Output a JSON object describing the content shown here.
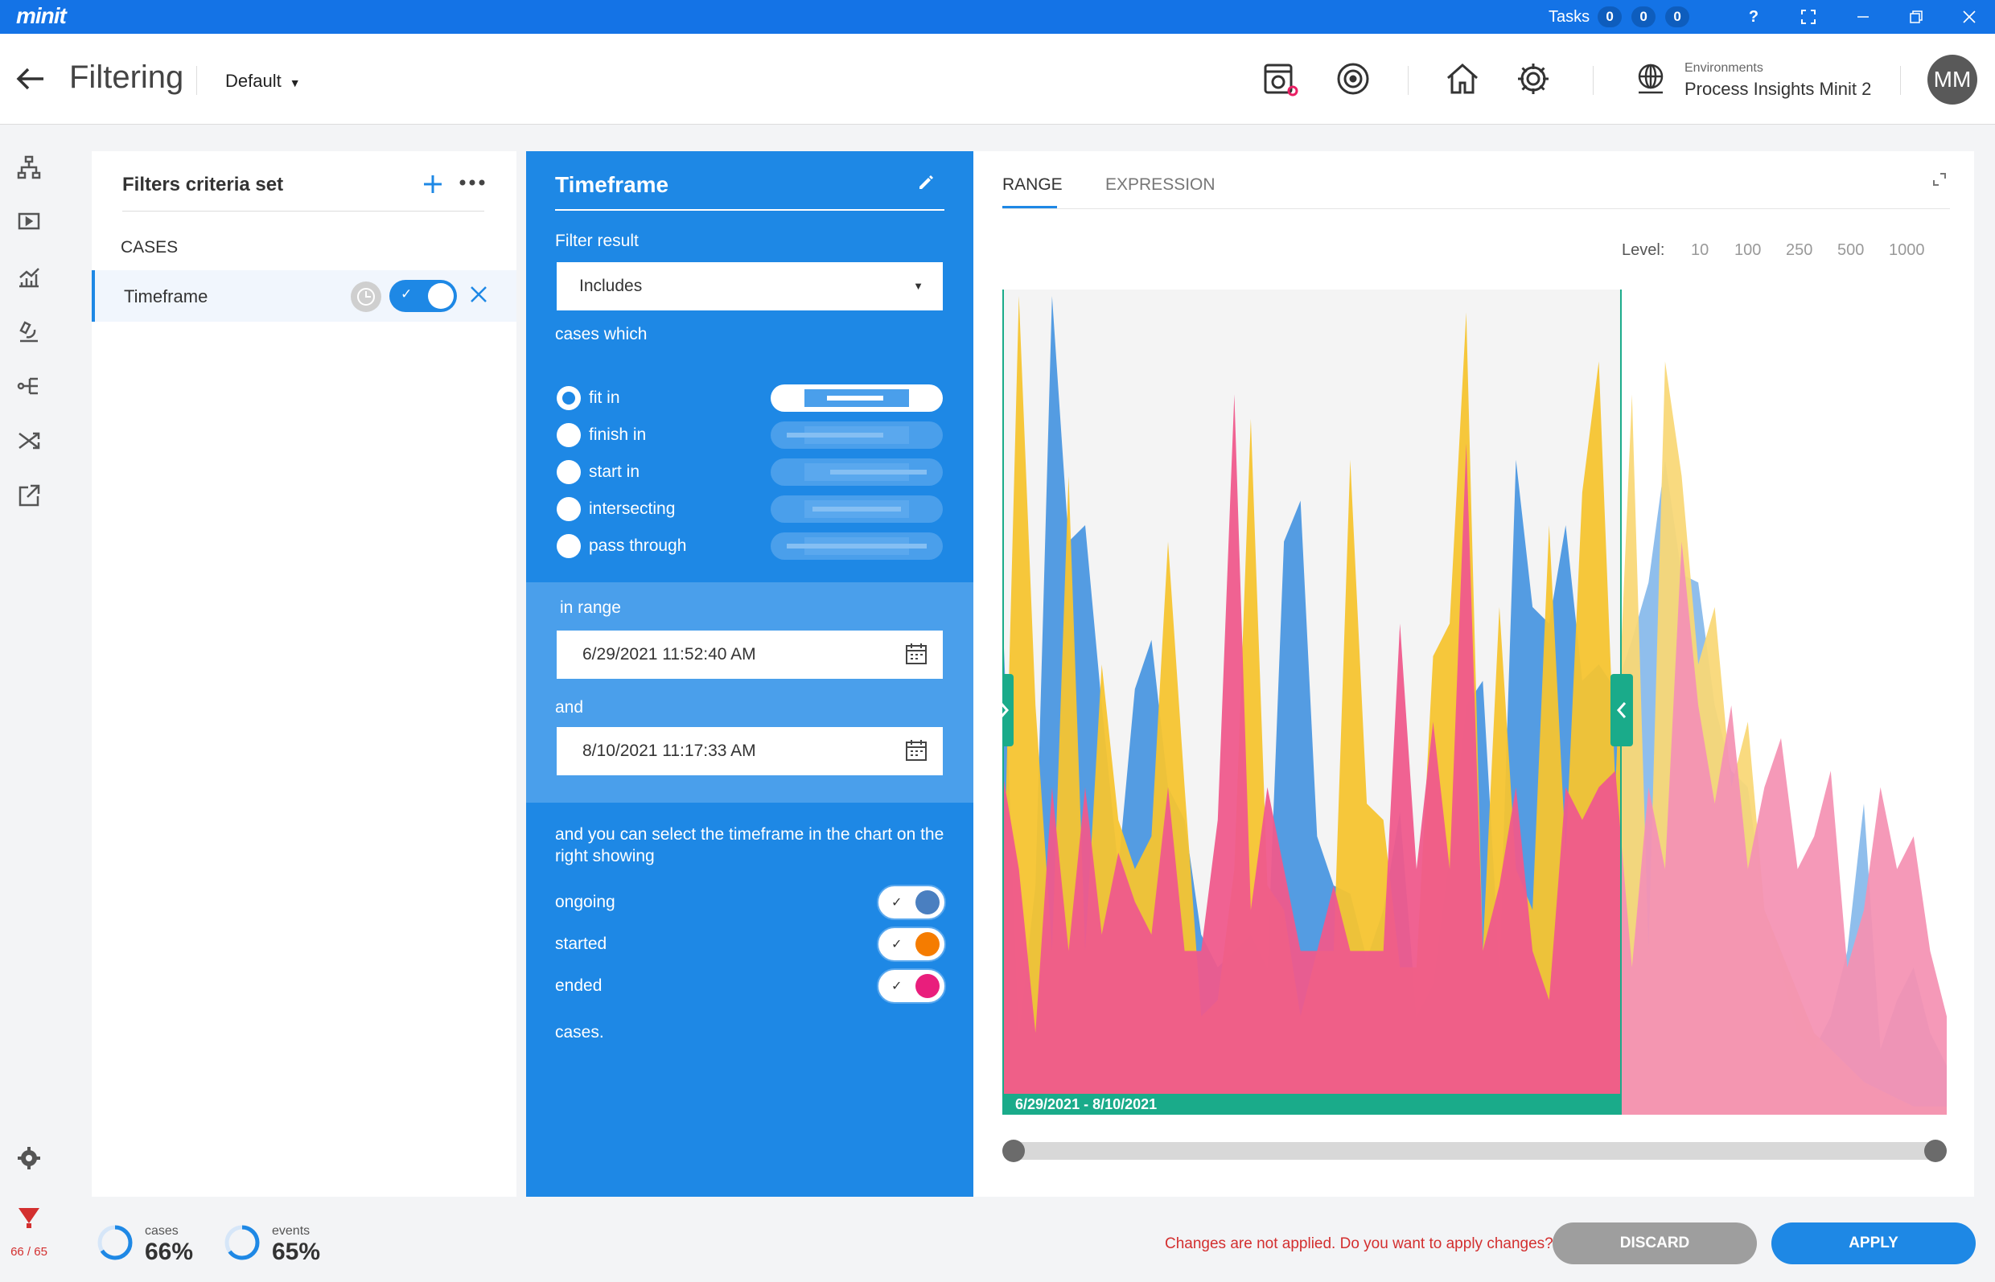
{
  "app": {
    "logo": "minit",
    "tasks_label": "Tasks",
    "task_counts": [
      "0",
      "0",
      "0"
    ],
    "help": "?"
  },
  "header": {
    "page_title": "Filtering",
    "view_dropdown": "Default",
    "environments_label": "Environments",
    "environment_name": "Process Insights Minit 2",
    "avatar_initials": "MM"
  },
  "nav": {
    "filter_count": "66 / 65"
  },
  "filters_panel": {
    "title": "Filters criteria set",
    "section": "CASES",
    "items": [
      {
        "label": "Timeframe",
        "enabled": true
      }
    ]
  },
  "timeframe": {
    "title": "Timeframe",
    "filter_result_label": "Filter result",
    "filter_result_value": "Includes",
    "cases_which": "cases which",
    "modes": [
      {
        "label": "fit in",
        "selected": true
      },
      {
        "label": "finish in",
        "selected": false
      },
      {
        "label": "start in",
        "selected": false
      },
      {
        "label": "intersecting",
        "selected": false
      },
      {
        "label": "pass through",
        "selected": false
      }
    ],
    "in_range_label": "in range",
    "start": "6/29/2021 11:52:40 AM",
    "and_label": "and",
    "end": "8/10/2021 11:17:33 AM",
    "select_text": "and you can select the timeframe in the chart on the right showing",
    "toggles": [
      {
        "label": "ongoing",
        "on": true,
        "color": "#4a7fc0"
      },
      {
        "label": "started",
        "on": true,
        "color": "#f57c00"
      },
      {
        "label": "ended",
        "on": true,
        "color": "#e91e7c"
      }
    ],
    "cases_suffix": "cases."
  },
  "chart_panel": {
    "tabs": [
      {
        "label": "RANGE",
        "active": true
      },
      {
        "label": "EXPRESSION",
        "active": false
      }
    ],
    "level_label": "Level:",
    "levels": [
      "10",
      "100",
      "250",
      "500",
      "1000"
    ],
    "selected_level": "100"
  },
  "chart_data": {
    "type": "area",
    "selection_label": "6/29/2021 - 8/10/2021",
    "selection_fraction": [
      0.0,
      0.655
    ],
    "ylim": [
      0,
      100
    ],
    "series": [
      {
        "name": "ongoing",
        "color": "#4b97e0",
        "values": [
          62,
          10,
          28,
          100,
          70,
          72,
          50,
          30,
          52,
          58,
          40,
          36,
          22,
          18,
          20,
          22,
          18,
          70,
          75,
          34,
          28,
          27,
          19,
          25,
          37,
          12,
          16,
          32,
          50,
          53,
          18,
          80,
          62,
          60,
          72,
          53,
          55,
          52,
          58,
          65,
          80,
          66,
          65,
          50,
          42,
          40,
          25,
          18,
          10,
          8,
          12,
          20,
          38,
          8,
          14,
          18,
          10,
          6
        ]
      },
      {
        "name": "started",
        "color": "#f5c430",
        "values": [
          22,
          100,
          50,
          20,
          78,
          20,
          55,
          36,
          30,
          34,
          70,
          40,
          12,
          14,
          30,
          85,
          28,
          25,
          12,
          20,
          20,
          80,
          38,
          36,
          18,
          18,
          56,
          60,
          98,
          20,
          62,
          30,
          25,
          72,
          32,
          76,
          92,
          40,
          88,
          20,
          92,
          78,
          55,
          62,
          40,
          48,
          25,
          20,
          15,
          10,
          8,
          6,
          4,
          3,
          2,
          1,
          1,
          1
        ]
      },
      {
        "name": "ended",
        "color": "#ef5a8c",
        "values": [
          42,
          30,
          10,
          40,
          20,
          40,
          22,
          32,
          26,
          22,
          40,
          20,
          20,
          36,
          88,
          25,
          40,
          30,
          20,
          20,
          28,
          20,
          20,
          20,
          60,
          30,
          48,
          30,
          82,
          20,
          28,
          40,
          20,
          14,
          40,
          36,
          40,
          42,
          18,
          40,
          30,
          70,
          50,
          38,
          50,
          30,
          40,
          46,
          30,
          34,
          42,
          18,
          25,
          40,
          30,
          34,
          20,
          12
        ]
      }
    ]
  },
  "footer": {
    "cases_label": "cases",
    "cases_pct": "66%",
    "cases_value": 0.66,
    "events_label": "events",
    "events_pct": "65%",
    "events_value": 0.65,
    "warning": "Changes are not applied. Do you want to apply changes?",
    "discard": "DISCARD",
    "apply": "APPLY"
  }
}
